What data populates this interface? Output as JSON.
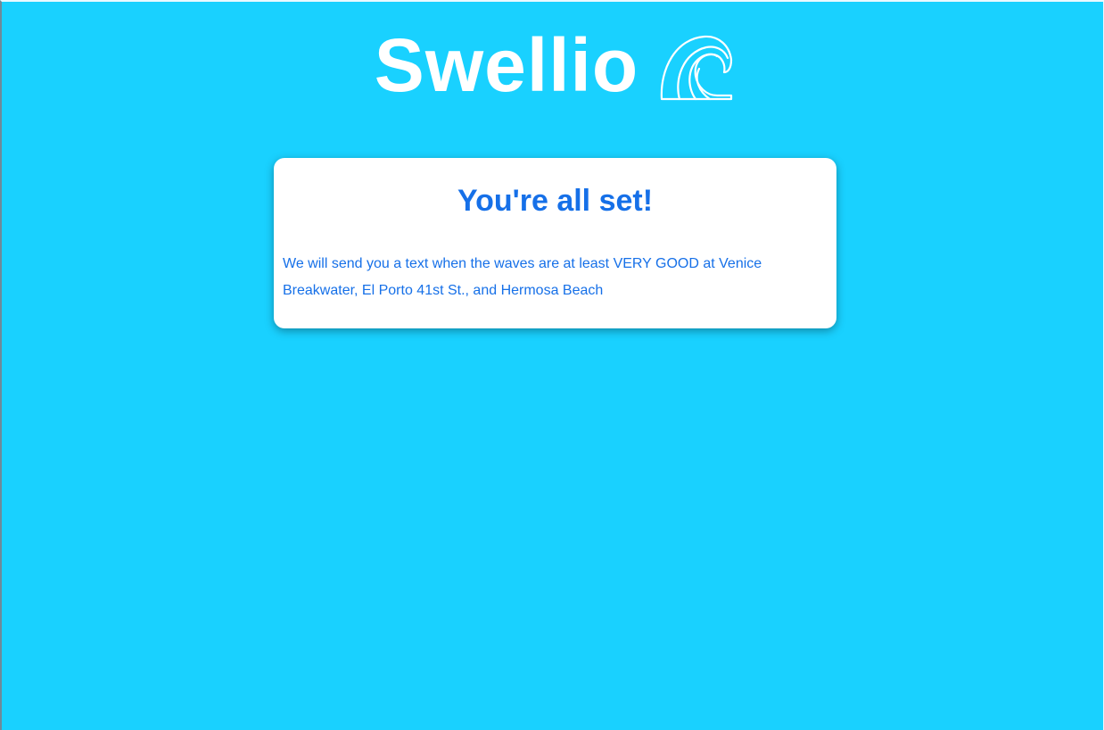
{
  "brand": {
    "title": "Swellio",
    "icon": "wave-icon"
  },
  "card": {
    "title": "You're all set!",
    "message": "We will send you a text when the waves are at least VERY GOOD at Venice Breakwater, El Porto 41st St., and Hermosa Beach"
  },
  "colors": {
    "background": "#19d1ff",
    "accent": "#1670e8",
    "card": "#ffffff",
    "brand_text": "#ffffff"
  }
}
